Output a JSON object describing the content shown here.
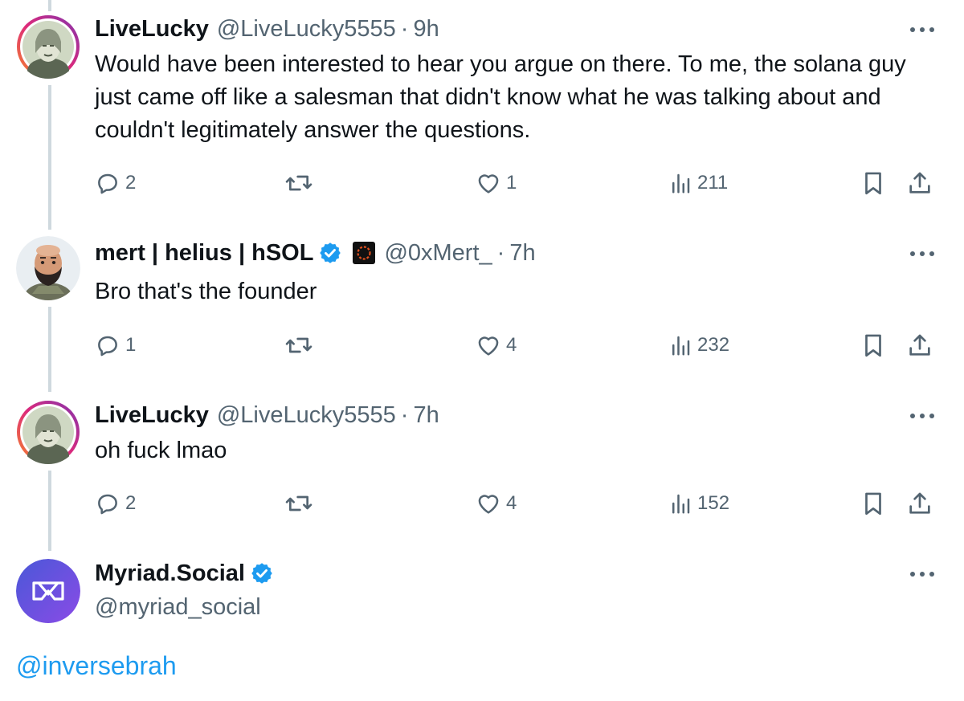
{
  "tweets": [
    {
      "name": "LiveLucky",
      "handle": "@LiveLucky5555",
      "time": "9h",
      "text": "Would have been interested to hear you argue on there.  To me, the solana guy just came off like a salesman that didn't know what he was talking about and couldn't legitimately answer the questions.",
      "replies": "2",
      "likes": "1",
      "views": "211",
      "avatar_icon": "dollar-bill-portrait-avatar"
    },
    {
      "name": "mert | helius | hSOL",
      "handle": "@0xMert_",
      "time": "7h",
      "text": "Bro that's the founder",
      "replies": "1",
      "likes": "4",
      "views": "232",
      "avatar_icon": "bearded-man-avatar",
      "badges": [
        "verified-badge-icon",
        "affiliate-flair-icon"
      ]
    },
    {
      "name": "LiveLucky",
      "handle": "@LiveLucky5555",
      "time": "7h",
      "text": "oh fuck lmao",
      "replies": "2",
      "likes": "4",
      "views": "152",
      "avatar_icon": "dollar-bill-portrait-avatar"
    }
  ],
  "separator": "·",
  "myriad": {
    "name": "Myriad.Social",
    "handle": "@myriad_social",
    "mention": "@inversebrah",
    "avatar_icon": "myriad-logo-avatar"
  },
  "colors": {
    "text": "#0f1419",
    "secondary": "#536471",
    "link": "#1d9bf0",
    "verified": "#1d9bf0",
    "thread_line": "#cfd9de",
    "myriad_gradient_start": "#4a58d8",
    "myriad_gradient_end": "#8a4be6"
  },
  "icons": {
    "reply": "reply-icon",
    "retweet": "retweet-icon",
    "like": "heart-icon",
    "views": "views-chart-icon",
    "bookmark": "bookmark-icon",
    "share": "share-icon",
    "more": "more-dots-icon"
  }
}
